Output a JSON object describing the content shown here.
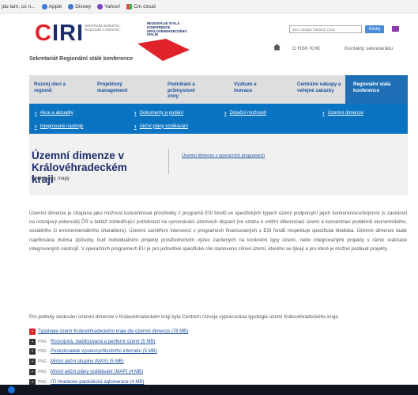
{
  "bookmarks": [
    {
      "label": "jdu tam, co n..."
    },
    {
      "label": "Apple"
    },
    {
      "label": "Disney"
    },
    {
      "label": "Yahoo!"
    },
    {
      "label": "Cm cloud"
    }
  ],
  "header": {
    "logo_text": "CIRI",
    "logo_subtitle": "CENTRUM INVESTIC, ROZVOJE A INOVACÍ",
    "partner_text": "REGIONÁLNÍ STÁLÁ KONFERENCE KRÁLOVÉHRADECKÉHO KRAJE",
    "org_name": "Sekretariát Regionální stálé konference",
    "search_placeholder": "Sem zadejte hledaný výraz",
    "search_button": "Hledej",
    "top_links": [
      "O RSK KHK",
      "Kontakty sekretariátu"
    ]
  },
  "mainnav": [
    {
      "label": "Rozvoj obcí a regionů"
    },
    {
      "label": "Projektový management"
    },
    {
      "label": "Podnikání a průmyslové zóny"
    },
    {
      "label": "Výzkum a inovace"
    },
    {
      "label": "Centrální nákupy a veřejné zakázky"
    },
    {
      "label": "Regionální stálá konference"
    }
  ],
  "subnav": [
    {
      "label": "Akce a aktuality"
    },
    {
      "label": "Dokumenty a podání"
    },
    {
      "label": "Dotační možnosti"
    },
    {
      "label": "Územní dimenze"
    },
    {
      "label": "Integrované nástroje"
    },
    {
      "label": "Akční plány vzdělávání"
    }
  ],
  "page": {
    "title": "Územní dimenze v Královéhradeckém kraji",
    "subtitle": "Dokumenty, mapy",
    "related_link": "Územní dimenze v operačních programech",
    "paragraph1": "Územní dimenze je chápána jako možnost koncentrovat prostředky z programů ESI fondů ve specifických typech území podporující jejich konkurenceschopnost (v závislosti na rozvojový potenciál) ČR a taktéž zohledňující potřebnost na vyrovnávání územních disparit (ve vztahu k vnitřní diferenciaci území a koncentraci problémů ekonomického, sociálního či environmentálního charakteru). Územní zaměření intervencí v programech financovaných z ESI fondů respektuje specifická hlediska. Územní dimenze bude naplňována dvěma způsoby, buď individuálními projekty prostřednictvím výzev zacílených na konkrétní typy území, nebo integrovanými projekty v rámci realizace integrovaných nástrojů. V operačních programech EU je pro jednotlivé specifické cíle stanoveno cílové území, kterého se týkají a pro které je možné podávat projekty.",
    "paragraph2": "Pro potřeby sledování územní dimenze v Královéhradeckém kraji byla Centrem rozvoje vypracována typologie území Královéhradeckého kraje."
  },
  "files": [
    {
      "type": "PDF",
      "label": "Typologie území Královéhradeckého kraje dle územní dimenze (78 MB)"
    },
    {
      "type": "PNG",
      "label": "Rozvojová, stabilizovaná a periferní území (5 MB)"
    },
    {
      "type": "PNG",
      "label": "Poskytovatelé vysokorychlostního internetu (5 MB)"
    },
    {
      "type": "PNG",
      "label": "Místní akční skupiny (MAS) (5 MB)"
    },
    {
      "type": "PNG",
      "label": "Místní akční plány vzdělávání (MAP) (4 MB)"
    },
    {
      "type": "PNG",
      "label": "ITI Hradecko-pardubická aglomerace (4 MB)"
    }
  ],
  "colors": {
    "accent_blue": "#0b74c2",
    "nav_bg": "#dedede",
    "title_navy": "#1c2d6b",
    "logo_red": "#e0222b"
  }
}
